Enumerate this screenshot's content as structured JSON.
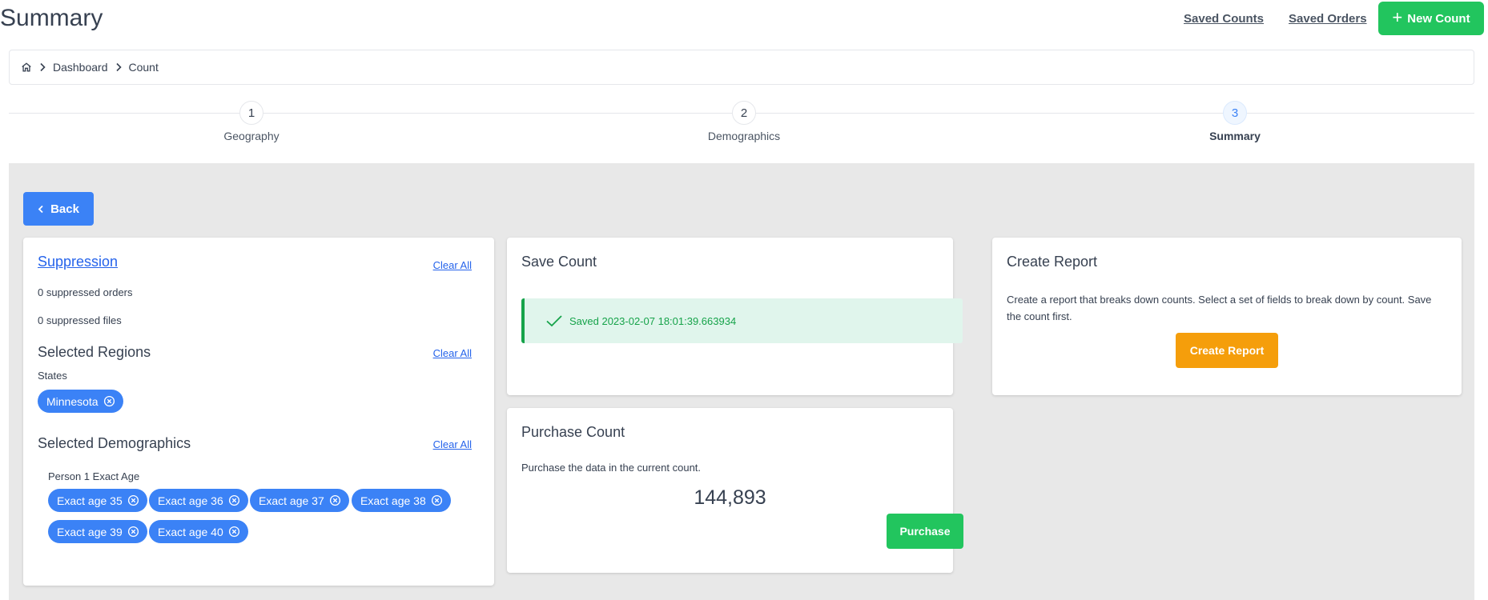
{
  "header": {
    "title": "Summary",
    "links": {
      "saved_counts": "Saved Counts",
      "saved_orders": "Saved Orders"
    },
    "new_count_label": "New Count"
  },
  "breadcrumb": {
    "items": [
      "Dashboard",
      "Count"
    ]
  },
  "stepper": {
    "steps": [
      {
        "number": "1",
        "label": "Geography"
      },
      {
        "number": "2",
        "label": "Demographics"
      },
      {
        "number": "3",
        "label": "Summary"
      }
    ],
    "active_step": 3
  },
  "back_label": "Back",
  "suppression": {
    "title": "Suppression",
    "clear_label": "Clear All",
    "orders_text": "0 suppressed orders",
    "files_text": "0 suppressed files"
  },
  "regions": {
    "title": "Selected Regions",
    "clear_label": "Clear All",
    "group_label": "States",
    "chips": [
      "Minnesota"
    ]
  },
  "demographics": {
    "title": "Selected Demographics",
    "clear_label": "Clear All",
    "group_label": "Person 1 Exact Age",
    "chips": [
      "Exact age 35",
      "Exact age 36",
      "Exact age 37",
      "Exact age 38",
      "Exact age 39",
      "Exact age 40"
    ]
  },
  "save_count": {
    "title": "Save Count",
    "status": "Saved 2023-02-07 18:01:39.663934"
  },
  "purchase_count": {
    "title": "Purchase Count",
    "description": "Purchase the data in the current count.",
    "count": "144,893",
    "button_label": "Purchase"
  },
  "create_report": {
    "title": "Create Report",
    "description": "Create a report that breaks down counts. Select a set of fields to break down by count. Save the count first.",
    "button_label": "Create Report"
  },
  "colors": {
    "primary": "#3b82f6",
    "success": "#22c55e",
    "warning": "#f59e0b",
    "background": "#e8e8e8"
  }
}
